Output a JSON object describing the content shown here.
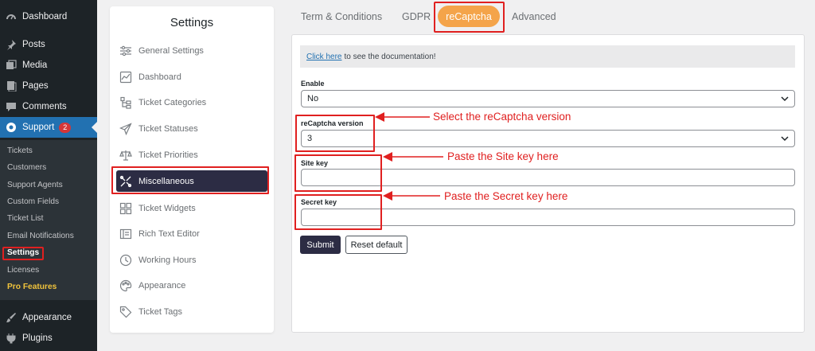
{
  "wp_menu": {
    "dashboard": "Dashboard",
    "posts": "Posts",
    "media": "Media",
    "pages": "Pages",
    "comments": "Comments",
    "support": "Support",
    "support_badge": "2",
    "appearance": "Appearance",
    "plugins": "Plugins"
  },
  "support_submenu": {
    "tickets": "Tickets",
    "customers": "Customers",
    "support_agents": "Support Agents",
    "custom_fields": "Custom Fields",
    "ticket_list": "Ticket List",
    "email_notifications": "Email Notifications",
    "settings": "Settings",
    "licenses": "Licenses",
    "pro_features": "Pro Features"
  },
  "settings_panel": {
    "title": "Settings",
    "items": [
      {
        "label": "General Settings",
        "icon": "sliders-icon"
      },
      {
        "label": "Dashboard",
        "icon": "chart-icon"
      },
      {
        "label": "Ticket Categories",
        "icon": "hierarchy-icon"
      },
      {
        "label": "Ticket Statuses",
        "icon": "send-icon"
      },
      {
        "label": "Ticket Priorities",
        "icon": "balance-icon"
      },
      {
        "label": "Miscellaneous",
        "icon": "tools-icon"
      },
      {
        "label": "Ticket Widgets",
        "icon": "grid-icon"
      },
      {
        "label": "Rich Text Editor",
        "icon": "editor-icon"
      },
      {
        "label": "Working Hours",
        "icon": "clock-icon"
      },
      {
        "label": "Appearance",
        "icon": "palette-icon"
      },
      {
        "label": "Ticket Tags",
        "icon": "tag-icon"
      }
    ]
  },
  "tabs": {
    "terms": "Term & Conditions",
    "gdpr": "GDPR",
    "recaptcha": "reCaptcha",
    "advanced": "Advanced"
  },
  "form": {
    "doc_link": "Click here",
    "doc_text": "to see the documentation!",
    "enable_label": "Enable",
    "enable_value": "No",
    "version_label": "reCaptcha version",
    "version_value": "3",
    "site_key_label": "Site key",
    "site_key_value": "",
    "secret_key_label": "Secret key",
    "secret_key_value": "",
    "submit": "Submit",
    "reset": "Reset default"
  },
  "annotations": {
    "version": "Select the reCaptcha version",
    "site_key": "Paste the Site key here",
    "secret_key": "Paste the Secret key here"
  },
  "colors": {
    "accent": "#f4a44a",
    "highlight": "#e02020",
    "dark": "#2c2c44"
  }
}
